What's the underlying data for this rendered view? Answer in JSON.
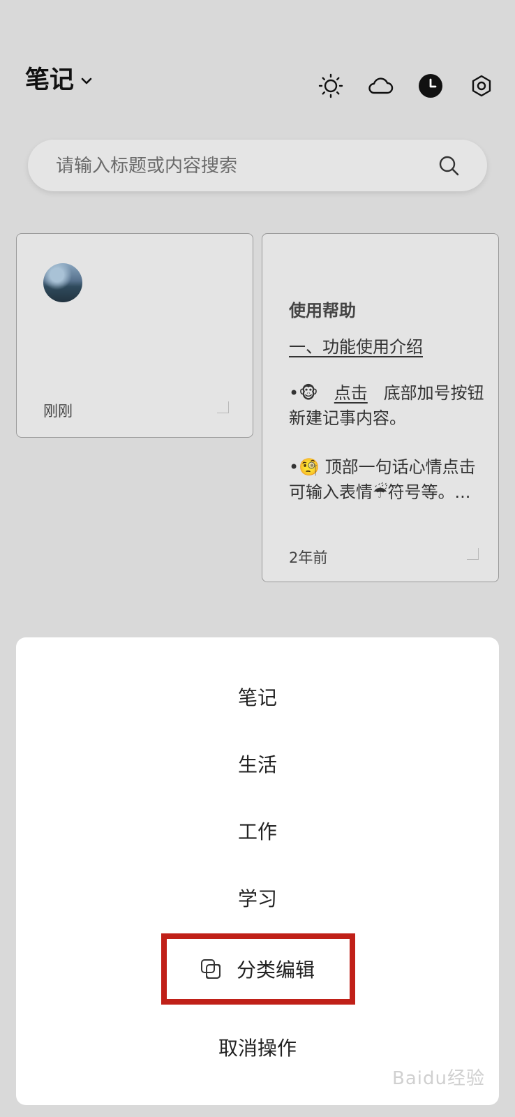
{
  "header": {
    "title": "笔记",
    "icons": [
      "sun-icon",
      "cloud-icon",
      "clock-icon",
      "settings-icon"
    ]
  },
  "search": {
    "placeholder": "请输入标题或内容搜索"
  },
  "notes": [
    {
      "time": "刚刚"
    },
    {
      "title": "使用帮助",
      "subtitle": "一、功能使用介绍",
      "para1_emoji": "🐵",
      "para1_link": "点击",
      "para1_text": "底部加号按钮 新建记事内容。",
      "para2_emoji": "🧐",
      "para2_text_a": "顶部一句话心情点击可输入表情",
      "para2_emoji2": "☔",
      "para2_text_b": "符号等。...",
      "time": "2年前"
    }
  ],
  "sheet": {
    "items": [
      "笔记",
      "生活",
      "工作",
      "学习"
    ],
    "edit_label": "分类编辑",
    "cancel_label": "取消操作"
  },
  "watermark": "Baidu经验",
  "colors": {
    "background": "#d9d9d9",
    "card": "#e4e4e4",
    "highlight": "#c02018"
  }
}
